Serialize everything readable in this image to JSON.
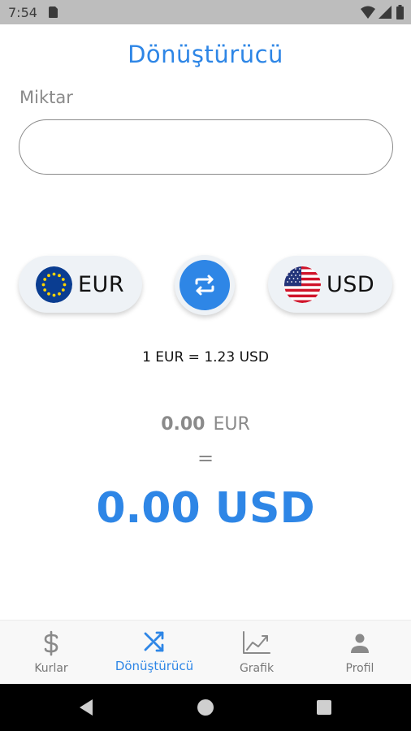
{
  "status_bar": {
    "time": "7:54",
    "icons": [
      "sim-card-icon",
      "wifi-icon",
      "signal-icon",
      "battery-icon"
    ]
  },
  "header": {
    "title": "Dönüştürücü"
  },
  "amount": {
    "label": "Miktar",
    "value": "",
    "placeholder": ""
  },
  "from_currency": {
    "code": "EUR",
    "flag": "eu-flag-icon"
  },
  "to_currency": {
    "code": "USD",
    "flag": "us-flag-icon"
  },
  "swap": {
    "icon": "swap-arrows-icon"
  },
  "rate": {
    "text": "1 EUR = 1.23 USD"
  },
  "conversion": {
    "source_amount": "0.00",
    "source_currency": "EUR",
    "equals": "=",
    "result": "0.00 USD"
  },
  "bottom_nav": {
    "items": [
      {
        "label": "Kurlar",
        "icon": "dollar-icon",
        "active": false
      },
      {
        "label": "Dönüştürücü",
        "icon": "shuffle-icon",
        "active": true
      },
      {
        "label": "Grafik",
        "icon": "chart-icon",
        "active": false
      },
      {
        "label": "Profil",
        "icon": "person-icon",
        "active": false
      }
    ]
  },
  "colors": {
    "accent": "#2e86e6",
    "pill_background": "#eef2f6",
    "muted_text": "#8a8a8a",
    "status_bar": "#bdbdbd"
  }
}
